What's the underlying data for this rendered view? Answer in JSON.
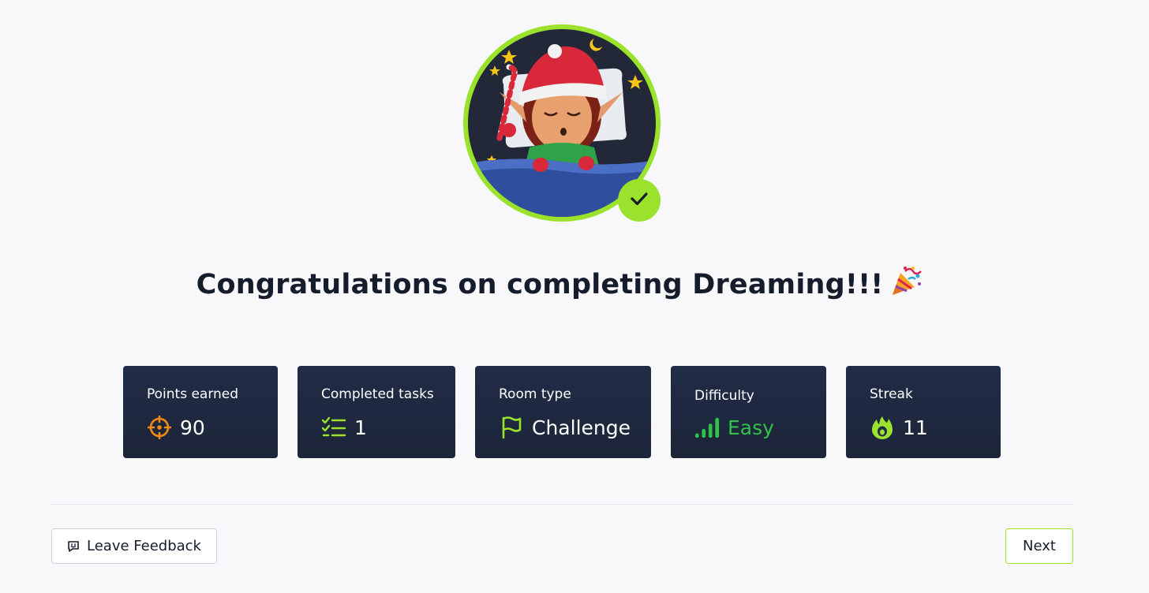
{
  "avatar": {
    "alt": "sleeping elf room badge",
    "badge_icon": "check-icon",
    "ring_color": "#9be22d"
  },
  "headline": {
    "text": "Congratulations on completing Dreaming!!!",
    "emoji_icon": "party-popper-icon"
  },
  "stats": [
    {
      "label": "Points earned",
      "value": "90",
      "icon": "crosshair-icon",
      "icon_color": "#f28a15"
    },
    {
      "label": "Completed tasks",
      "value": "1",
      "icon": "task-list-icon",
      "icon_color": "#9be22d"
    },
    {
      "label": "Room type",
      "value": "Challenge",
      "icon": "flag-icon",
      "icon_color": "#9be22d"
    },
    {
      "label": "Difficulty",
      "value": "Easy",
      "icon": "signal-bars-icon",
      "icon_color": "#31c24a",
      "value_color": "#31c24a"
    },
    {
      "label": "Streak",
      "value": "11",
      "icon": "flame-icon",
      "icon_color": "#9be22d"
    }
  ],
  "footer": {
    "feedback_label": "Leave Feedback",
    "feedback_icon": "message-icon",
    "next_label": "Next"
  },
  "colors": {
    "accent": "#9be22d",
    "card_bg": "#212c47",
    "page_bg": "#f8f8fb",
    "text_dark": "#151c2b"
  }
}
